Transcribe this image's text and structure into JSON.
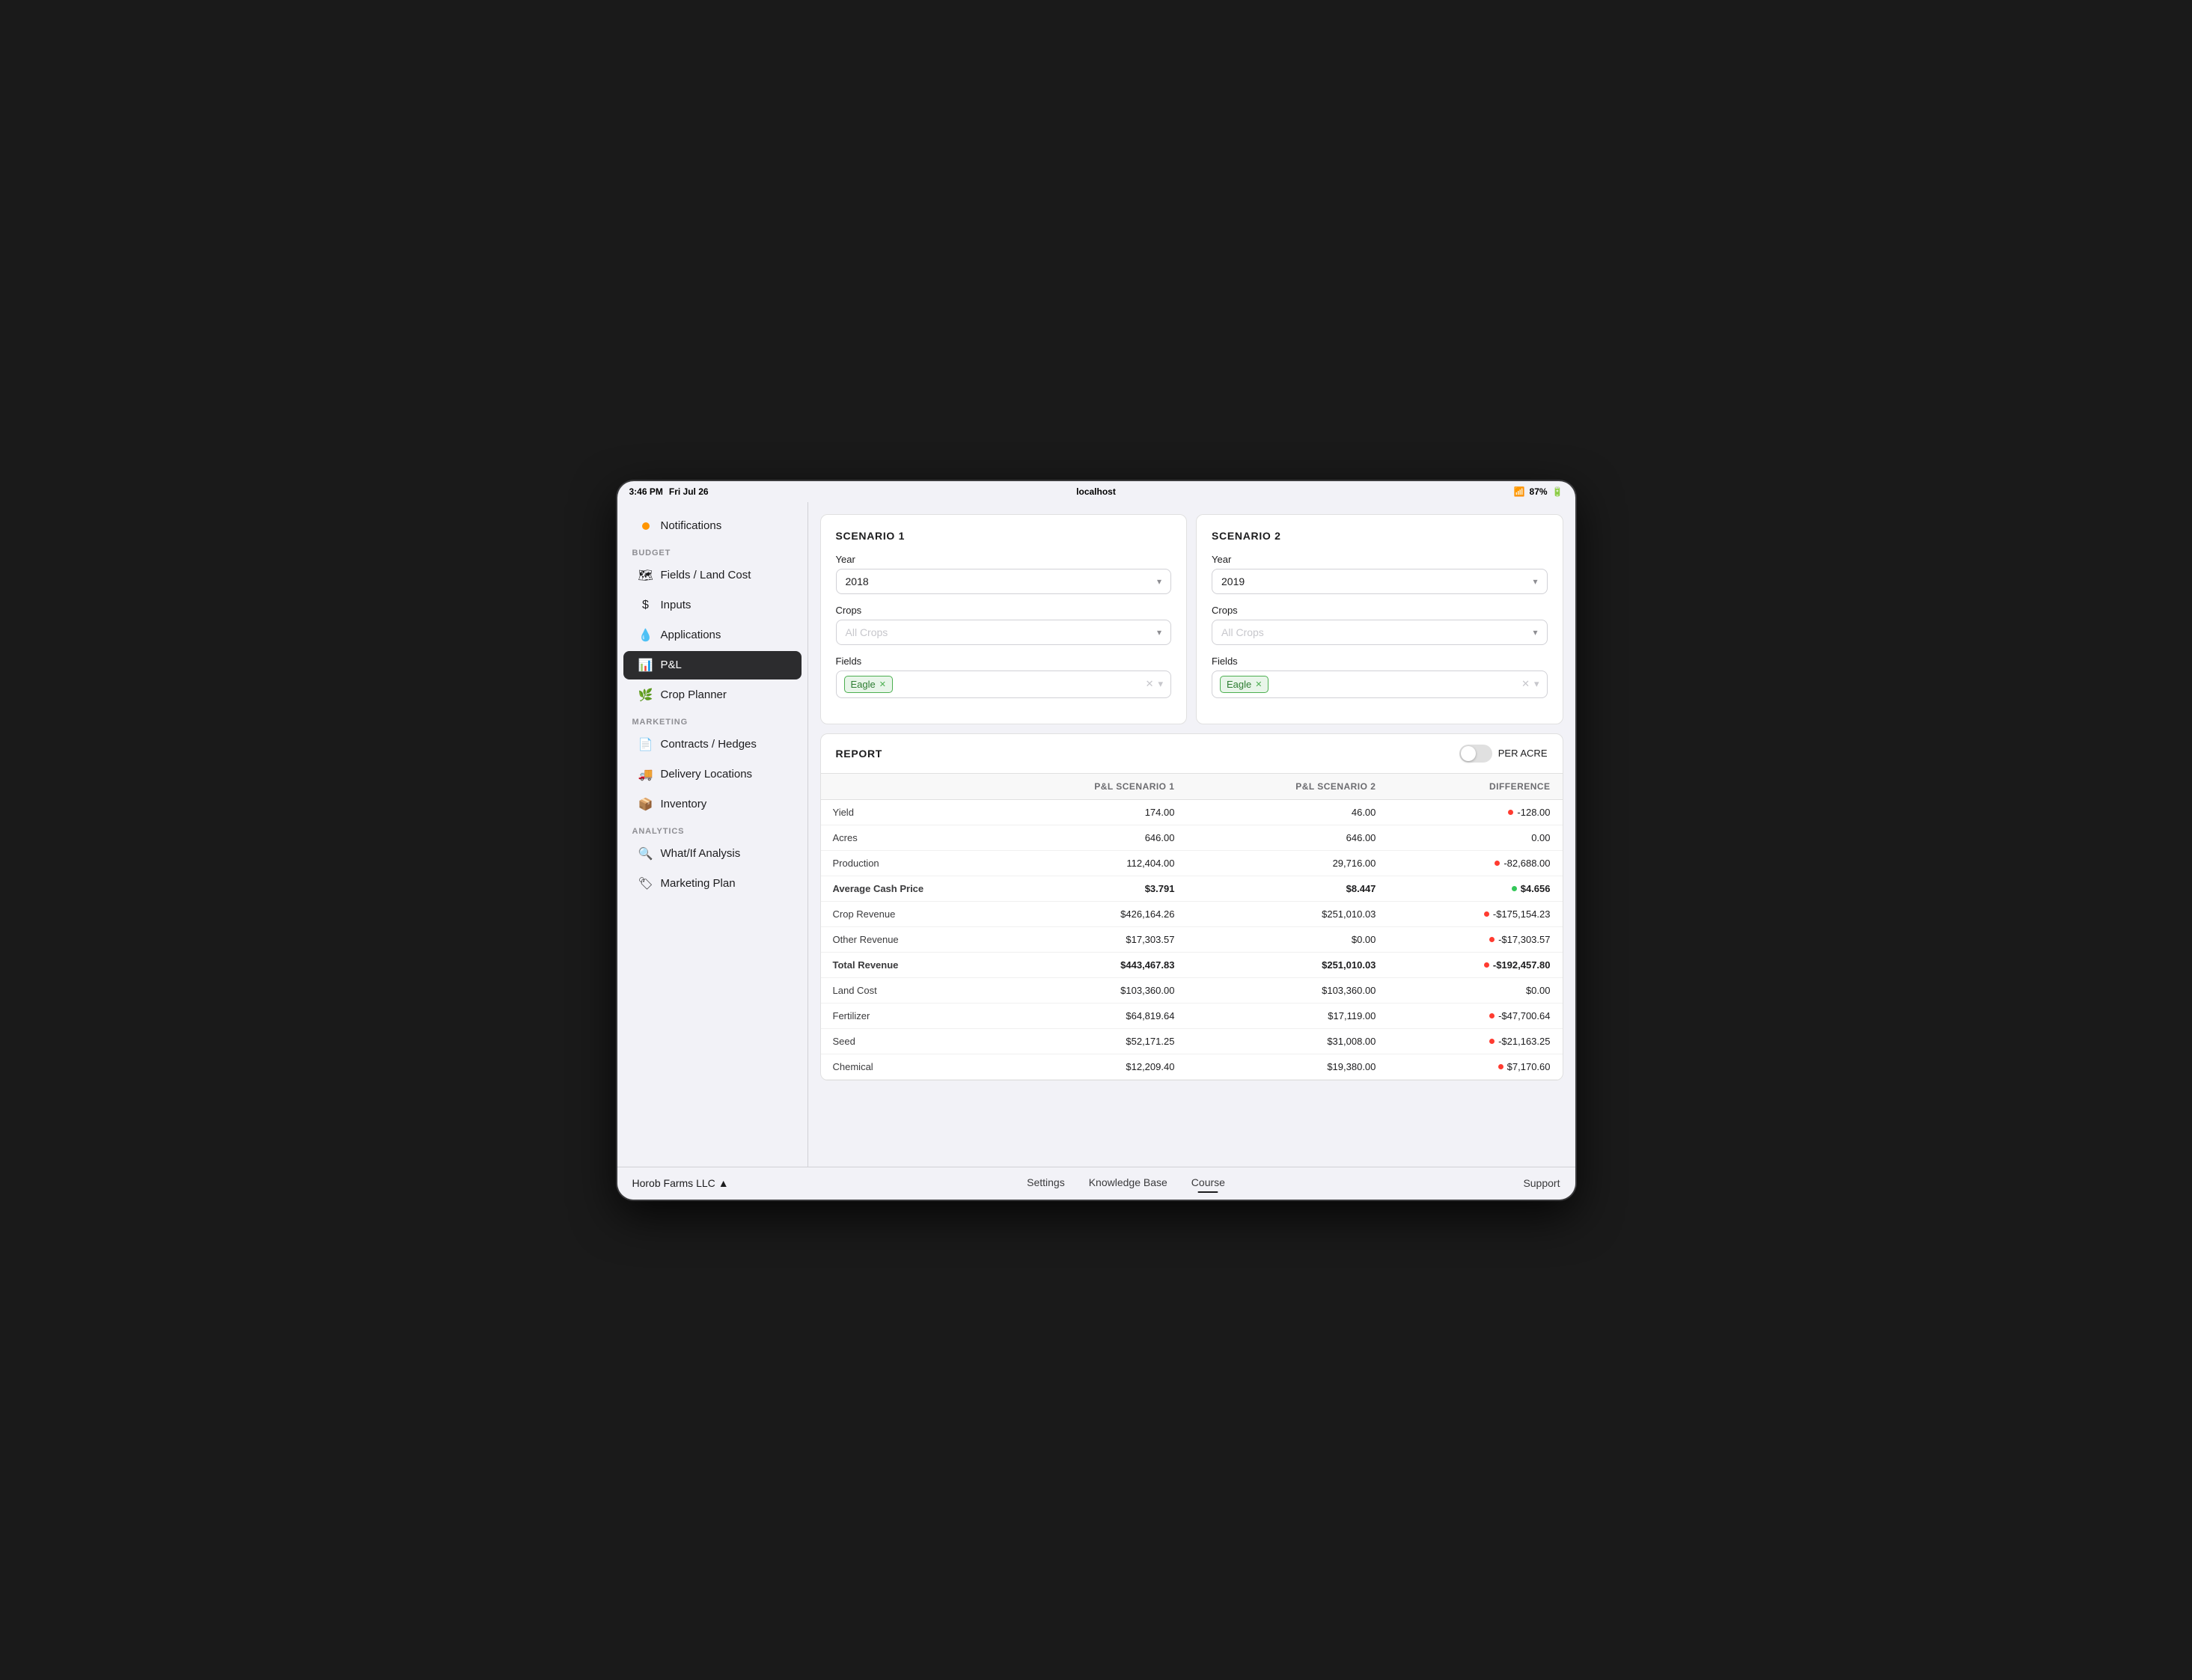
{
  "status_bar": {
    "time": "3:46 PM",
    "date": "Fri Jul 26",
    "url": "localhost",
    "battery": "87%"
  },
  "sidebar": {
    "notifications_label": "Notifications",
    "sections": [
      {
        "label": "BUDGET",
        "items": [
          {
            "id": "fields",
            "label": "Fields / Land Cost",
            "icon": "🗺"
          },
          {
            "id": "inputs",
            "label": "Inputs",
            "icon": "$"
          },
          {
            "id": "applications",
            "label": "Applications",
            "icon": "💧"
          },
          {
            "id": "pl",
            "label": "P&L",
            "icon": "📊",
            "active": true
          },
          {
            "id": "crop-planner",
            "label": "Crop Planner",
            "icon": "🌿"
          }
        ]
      },
      {
        "label": "MARKETING",
        "items": [
          {
            "id": "contracts",
            "label": "Contracts / Hedges",
            "icon": "📄"
          },
          {
            "id": "delivery",
            "label": "Delivery Locations",
            "icon": "🚚"
          },
          {
            "id": "inventory",
            "label": "Inventory",
            "icon": "📦"
          }
        ]
      },
      {
        "label": "ANALYTICS",
        "items": [
          {
            "id": "whatif",
            "label": "What/If Analysis",
            "icon": "🔍"
          },
          {
            "id": "marketing-plan",
            "label": "Marketing Plan",
            "icon": "🏷"
          }
        ]
      }
    ]
  },
  "scenario1": {
    "title": "SCENARIO 1",
    "year_label": "Year",
    "year_value": "2018",
    "crops_label": "Crops",
    "crops_placeholder": "All Crops",
    "fields_label": "Fields",
    "field_tag": "Eagle"
  },
  "scenario2": {
    "title": "SCENARIO 2",
    "year_label": "Year",
    "year_value": "2019",
    "crops_label": "Crops",
    "crops_placeholder": "All Crops",
    "fields_label": "Fields",
    "field_tag": "Eagle"
  },
  "report": {
    "title": "REPORT",
    "per_acre_label": "PER ACRE",
    "col_s1": "P&L SCENARIO 1",
    "col_s2": "P&L SCENARIO 2",
    "col_diff": "DIFFERENCE",
    "rows": [
      {
        "label": "Yield",
        "s1": "174.00",
        "s2": "46.00",
        "diff": "-128.00",
        "diff_color": "red",
        "bold": false
      },
      {
        "label": "Acres",
        "s1": "646.00",
        "s2": "646.00",
        "diff": "0.00",
        "diff_color": null,
        "bold": false
      },
      {
        "label": "Production",
        "s1": "112,404.00",
        "s2": "29,716.00",
        "diff": "-82,688.00",
        "diff_color": "red",
        "bold": false
      },
      {
        "label": "Average Cash Price",
        "s1": "$3.791",
        "s2": "$8.447",
        "diff": "$4.656",
        "diff_color": "green",
        "bold": true
      },
      {
        "label": "Crop Revenue",
        "s1": "$426,164.26",
        "s2": "$251,010.03",
        "diff": "-$175,154.23",
        "diff_color": "red",
        "bold": false
      },
      {
        "label": "Other Revenue",
        "s1": "$17,303.57",
        "s2": "$0.00",
        "diff": "-$17,303.57",
        "diff_color": "red",
        "bold": false
      },
      {
        "label": "Total Revenue",
        "s1": "$443,467.83",
        "s2": "$251,010.03",
        "diff": "-$192,457.80",
        "diff_color": "red",
        "bold": true
      },
      {
        "label": "Land Cost",
        "s1": "$103,360.00",
        "s2": "$103,360.00",
        "diff": "$0.00",
        "diff_color": null,
        "bold": false
      },
      {
        "label": "Fertilizer",
        "s1": "$64,819.64",
        "s2": "$17,119.00",
        "diff": "-$47,700.64",
        "diff_color": "red",
        "bold": false
      },
      {
        "label": "Seed",
        "s1": "$52,171.25",
        "s2": "$31,008.00",
        "diff": "-$21,163.25",
        "diff_color": "red",
        "bold": false
      },
      {
        "label": "Chemical",
        "s1": "$12,209.40",
        "s2": "$19,380.00",
        "diff": "$7,170.60",
        "diff_color": "red",
        "bold": false
      }
    ]
  },
  "bottom_bar": {
    "farm_name": "Horob Farms LLC",
    "tabs": [
      {
        "id": "settings",
        "label": "Settings",
        "active": false
      },
      {
        "id": "knowledge",
        "label": "Knowledge Base",
        "active": false
      },
      {
        "id": "course",
        "label": "Course",
        "active": true
      }
    ],
    "support_label": "Support"
  }
}
